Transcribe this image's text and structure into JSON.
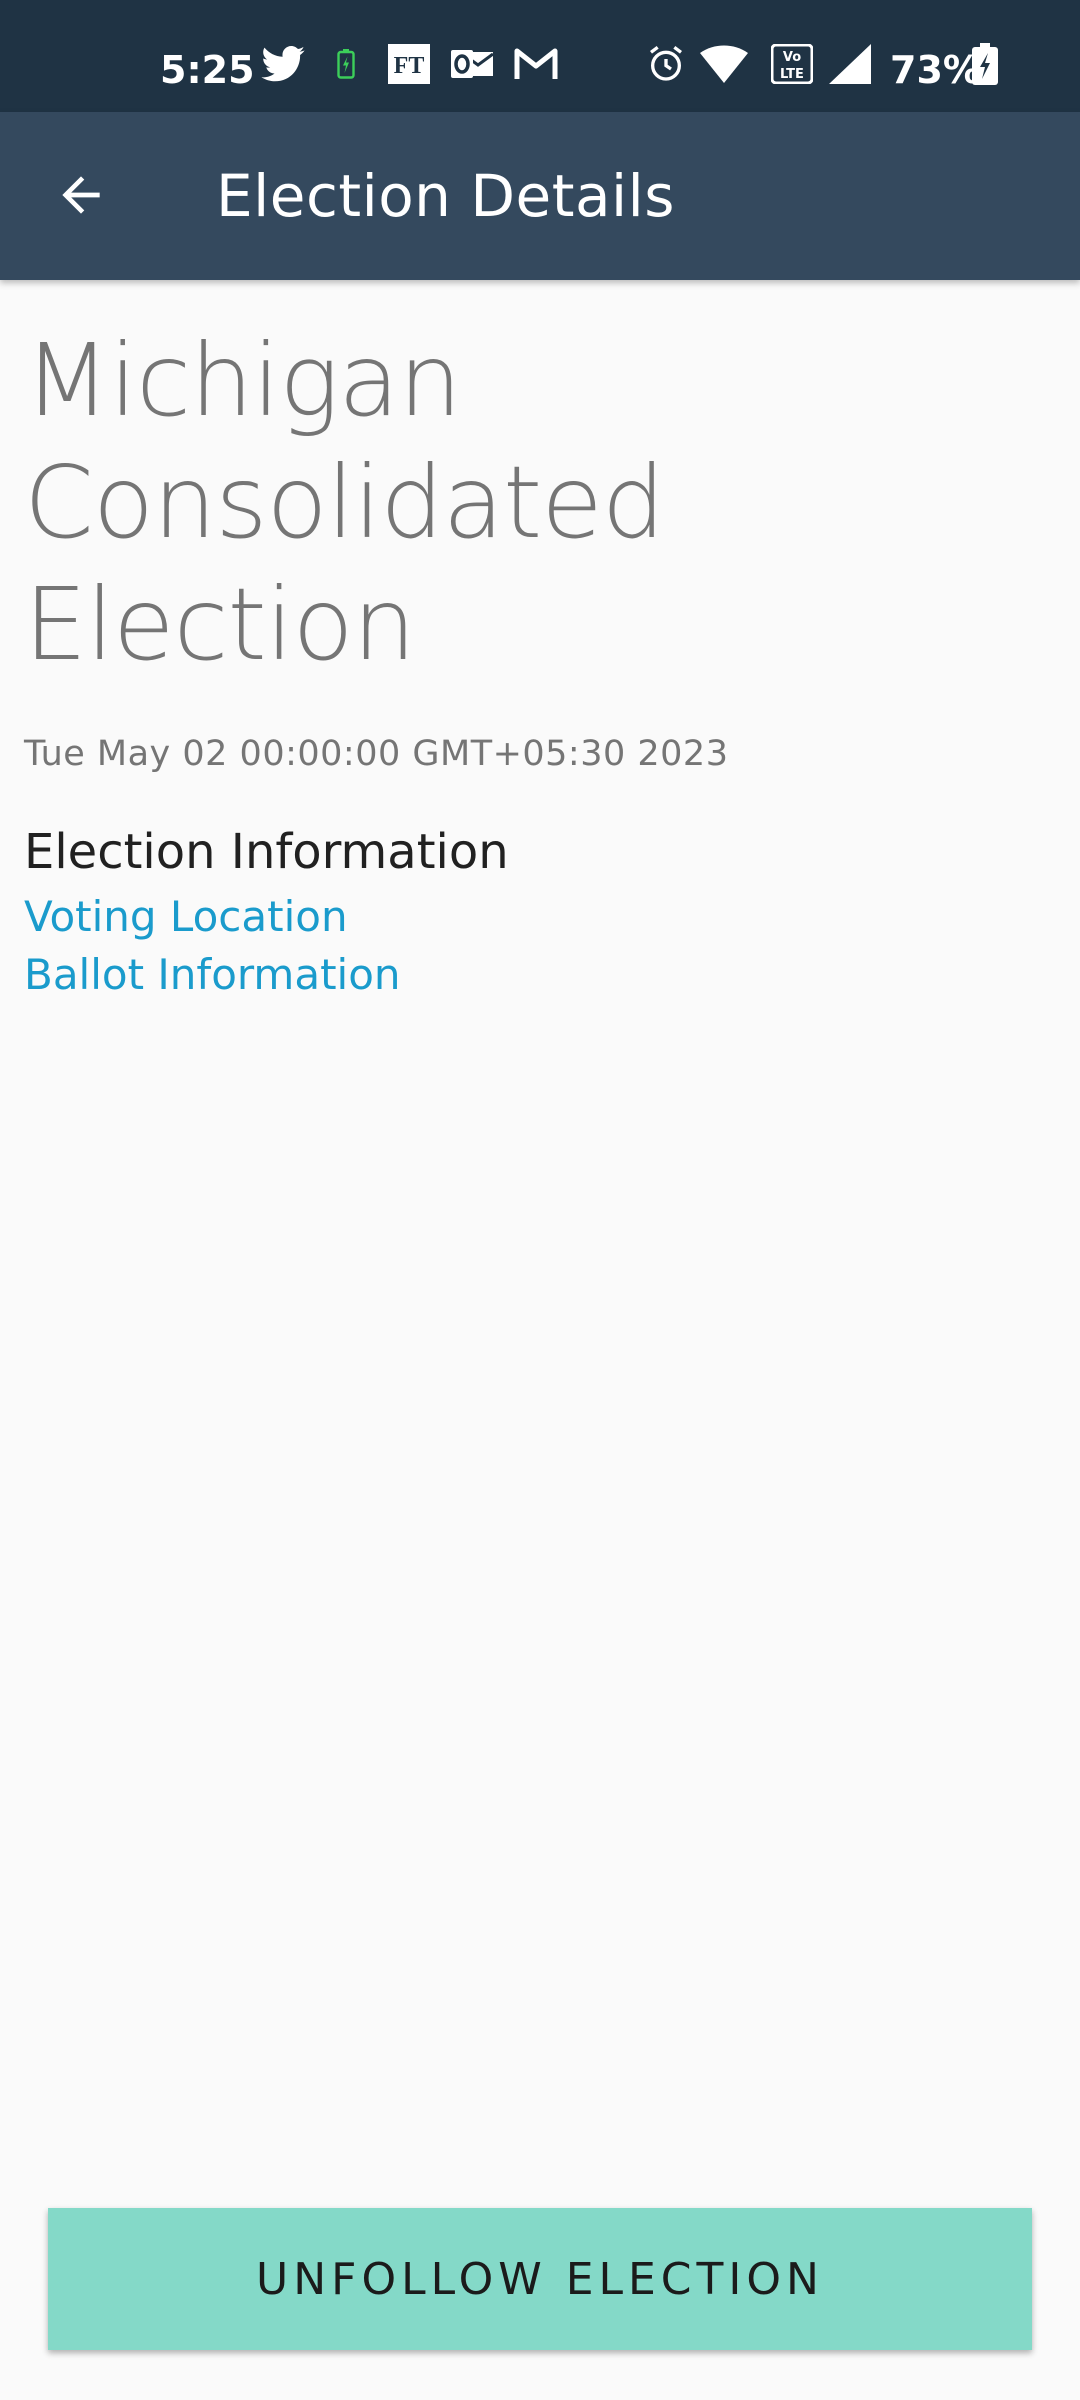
{
  "status_bar": {
    "time": "5:25",
    "battery_percent": "73%",
    "icons": [
      "twitter-icon",
      "battery-saver-icon",
      "ft-icon",
      "outlook-icon",
      "gmail-icon",
      "alarm-icon",
      "wifi-icon",
      "volte-icon",
      "signal-icon",
      "battery-charging-icon"
    ],
    "background_color": "#1f3344"
  },
  "app_bar": {
    "title": "Election Details",
    "back_icon": "arrow-back-icon",
    "background_color": "#34495e"
  },
  "election": {
    "name": "Michigan Consolidated Election",
    "date": "Tue May 02 00:00:00 GMT+05:30 2023"
  },
  "info": {
    "section_title": "Election Information",
    "links": [
      "Voting Location",
      "Ballot Information"
    ],
    "link_color": "#1a9bcc"
  },
  "action": {
    "unfollow_label": "UNFOLLOW ELECTION",
    "button_color": "#84d9c8"
  }
}
